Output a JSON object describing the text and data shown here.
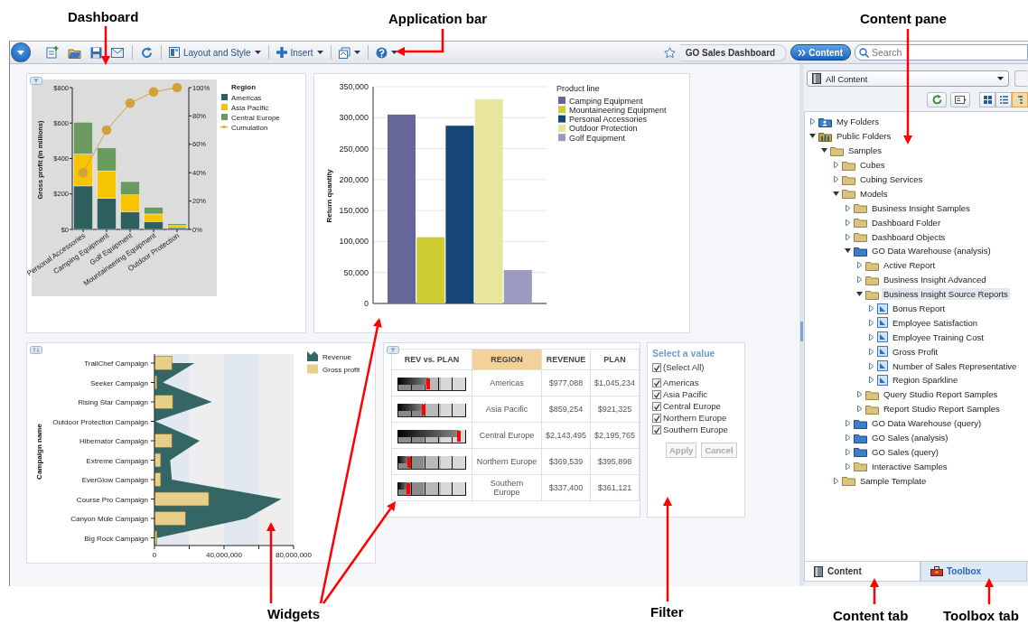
{
  "callouts": [
    {
      "text": "Dashboard"
    },
    {
      "text": "Application bar"
    },
    {
      "text": "Content pane"
    },
    {
      "text": "Widgets"
    },
    {
      "text": "Filter"
    },
    {
      "text": "Content tab"
    },
    {
      "text": "Toolbox tab"
    }
  ],
  "toolbar": {
    "menus": [
      {
        "label": "Layout and Style"
      },
      {
        "label": "Insert"
      }
    ],
    "dashboard_title": "GO Sales Dashboard",
    "content_button": "Content",
    "search": {
      "placeholder": "Search"
    }
  },
  "widgets": [
    {
      "kind": "pareto",
      "chart_data": {
        "type": "bar",
        "stacked": true,
        "ylabel": "Gross profit (in millions)",
        "legend": {
          "title": "Region"
        },
        "categories": [
          "Personal Accessories",
          "Camping Equipment",
          "Golf Equipment",
          "Mountaineering Equipment",
          "Outdoor Protection"
        ],
        "series": [
          {
            "name": "Americas",
            "color": "#2f5f5e",
            "values": [
              245,
              175,
              100,
              45,
              10
            ]
          },
          {
            "name": "Asia Pacific",
            "color": "#f6c400",
            "values": [
              180,
              155,
              95,
              42,
              12
            ]
          },
          {
            "name": "Central Europe",
            "color": "#6a9a5f",
            "values": [
              180,
              130,
              75,
              38,
              10
            ]
          },
          {
            "name": "Cumulation",
            "color": "#d4a03a",
            "type": "line",
            "axis": "y2",
            "marker": "circle",
            "values": [
              40,
              70,
              89,
              97,
              100
            ]
          }
        ],
        "ylim": [
          0,
          800
        ],
        "yticks": [
          {
            "value": 0,
            "label": "$0"
          },
          {
            "value": 200,
            "label": "$200"
          },
          {
            "value": 400,
            "label": "$400"
          },
          {
            "value": 600,
            "label": "$600"
          },
          {
            "value": 800,
            "label": "$800"
          }
        ],
        "y2lim": [
          0,
          100
        ],
        "y2ticks": [
          {
            "value": 0,
            "label": "0%"
          },
          {
            "value": 20,
            "label": "20%"
          },
          {
            "value": 40,
            "label": "40%"
          },
          {
            "value": 60,
            "label": "60%"
          },
          {
            "value": 80,
            "label": "80%"
          },
          {
            "value": 100,
            "label": "100%"
          }
        ]
      }
    },
    {
      "kind": "bar",
      "chart_data": {
        "type": "bar",
        "ylabel": "Return quantity",
        "grid": true,
        "legend": {
          "title": "Product line"
        },
        "series": [
          {
            "name": "Camping Equipment",
            "color": "#66669a",
            "values": [
              305000
            ]
          },
          {
            "name": "Mountaineering Equipment",
            "color": "#cdcd33",
            "values": [
              107000
            ]
          },
          {
            "name": "Personal Accessories",
            "color": "#154676",
            "values": [
              287000
            ]
          },
          {
            "name": "Outdoor Protection",
            "color": "#e8e69a",
            "values": [
              330000
            ]
          },
          {
            "name": "Golf Equipment",
            "color": "#9b9bc1",
            "values": [
              54000
            ]
          }
        ],
        "ylim": [
          0,
          350000
        ],
        "yticks": [
          {
            "value": 0,
            "label": "0"
          },
          {
            "value": 50000,
            "label": "50,000"
          },
          {
            "value": 100000,
            "label": "100,000"
          },
          {
            "value": 150000,
            "label": "150,000"
          },
          {
            "value": 200000,
            "label": "200,000"
          },
          {
            "value": 250000,
            "label": "250,000"
          },
          {
            "value": 300000,
            "label": "300,000"
          },
          {
            "value": 350000,
            "label": "350,000"
          }
        ]
      }
    },
    {
      "kind": "combo",
      "chart_data": {
        "type": "bar",
        "orientation": "horizontal",
        "ylabel": "Campaign name",
        "legend": true,
        "categories": [
          "TrailChef Campaign",
          "Seeker Campaign",
          "Rising Star Campaign",
          "Outdoor Protection Campaign",
          "Hibernator Campaign",
          "Extreme Campaign",
          "EverGlow Campaign",
          "Course Pro Campaign",
          "Canyon Mule Campaign",
          "Big Rock Campaign"
        ],
        "series": [
          {
            "name": "Revenue",
            "color": "#336664",
            "type": "area",
            "values": [
              23000000,
              4800000,
              33000000,
              500000,
              26000000,
              9000000,
              10000000,
              73000000,
              53000000,
              1700000
            ]
          },
          {
            "name": "Gross profit",
            "color": "#e6cf86",
            "values": [
              10000000,
              1400000,
              10500000,
              null,
              10000000,
              3600000,
              3600000,
              31200000,
              17800000,
              1400000
            ]
          }
        ],
        "bands": [
          {
            "axis": "x",
            "from": 0,
            "to": 20000000,
            "color": "#e2e8ef"
          },
          {
            "axis": "x",
            "from": 40000000,
            "to": 60000000,
            "color": "#e2e8ef"
          }
        ],
        "xlim": [
          0,
          80000000
        ],
        "xticks": [
          {
            "value": 0,
            "label": "0"
          },
          {
            "value": 40000000,
            "label": "40,000,000"
          },
          {
            "value": 80000000,
            "label": "80,000,000"
          }
        ]
      }
    },
    {
      "kind": "table",
      "columns": [
        {
          "label": "REV vs. PLAN",
          "selected": false
        },
        {
          "label": "REGION",
          "selected": true
        },
        {
          "label": "REVENUE",
          "selected": false
        },
        {
          "label": "PLAN",
          "selected": false
        }
      ],
      "rows": [
        {
          "region": "Americas",
          "revenue": "$977,088",
          "plan": "$1,045,234",
          "level": 0.45
        },
        {
          "region": "Asia Pacific",
          "revenue": "$859,254",
          "plan": "$921,325",
          "level": 0.38
        },
        {
          "region": "Central Europe",
          "revenue": "$2,143,495",
          "plan": "$2,195,765",
          "level": 0.9
        },
        {
          "region": "Northern Europe",
          "revenue": "$369,539",
          "plan": "$395,898",
          "level": 0.17
        },
        {
          "region": "Southern Europe",
          "revenue": "$337,400",
          "plan": "$361,121",
          "level": 0.16
        }
      ]
    },
    {
      "kind": "filter",
      "title": "Select a value",
      "options": [
        {
          "label": "(Select All)",
          "checked": true
        },
        {
          "label": "Americas",
          "checked": true
        },
        {
          "label": "Asia Pacific",
          "checked": true
        },
        {
          "label": "Central Europe",
          "checked": true
        },
        {
          "label": "Northern Europe",
          "checked": true
        },
        {
          "label": "Southern Europe",
          "checked": true
        }
      ],
      "buttons": [
        {
          "label": "Apply",
          "disabled": true
        },
        {
          "label": "Cancel",
          "disabled": true
        }
      ]
    }
  ],
  "content_pane": {
    "scope_dropdown": {
      "value": "All Content"
    },
    "view_buttons": [
      {
        "kind": "grid",
        "selected": false
      },
      {
        "kind": "list",
        "selected": false
      },
      {
        "kind": "tree",
        "selected": true
      }
    ],
    "tree": [
      {
        "label": "My Folders",
        "kind": "user-folder",
        "expanded": false,
        "selected": false
      },
      {
        "label": "Public Folders",
        "kind": "public-folder",
        "expanded": true,
        "selected": false,
        "children": [
          {
            "label": "Samples",
            "kind": "folder",
            "expanded": true,
            "selected": false,
            "children": [
              {
                "label": "Cubes",
                "kind": "folder",
                "expanded": false,
                "selected": false
              },
              {
                "label": "Cubing Services",
                "kind": "folder",
                "expanded": false,
                "selected": false
              },
              {
                "label": "Models",
                "kind": "folder",
                "expanded": true,
                "selected": false,
                "children": [
                  {
                    "label": "Business Insight Samples",
                    "kind": "folder",
                    "expanded": false,
                    "selected": false
                  },
                  {
                    "label": "Dashboard Folder",
                    "kind": "folder",
                    "expanded": false,
                    "selected": false
                  },
                  {
                    "label": "Dashboard Objects",
                    "kind": "folder",
                    "expanded": false,
                    "selected": false
                  },
                  {
                    "label": "GO Data Warehouse (analysis)",
                    "kind": "package",
                    "expanded": true,
                    "selected": false,
                    "children": [
                      {
                        "label": "Active Report",
                        "kind": "folder",
                        "expanded": false,
                        "selected": false
                      },
                      {
                        "label": "Business Insight Advanced",
                        "kind": "folder",
                        "expanded": false,
                        "selected": false
                      },
                      {
                        "label": "Business Insight Source Reports",
                        "kind": "folder",
                        "expanded": true,
                        "selected": true,
                        "children": [
                          {
                            "label": "Bonus Report",
                            "kind": "report",
                            "expanded": false,
                            "selected": false
                          },
                          {
                            "label": "Employee Satisfaction",
                            "kind": "report",
                            "expanded": false,
                            "selected": false
                          },
                          {
                            "label": "Employee Training Cost",
                            "kind": "report",
                            "expanded": false,
                            "selected": false
                          },
                          {
                            "label": "Gross Profit",
                            "kind": "report",
                            "expanded": false,
                            "selected": false
                          },
                          {
                            "label": "Number of Sales Representative",
                            "kind": "report",
                            "expanded": false,
                            "selected": false
                          },
                          {
                            "label": "Region Sparkline",
                            "kind": "report",
                            "expanded": false,
                            "selected": false
                          }
                        ]
                      },
                      {
                        "label": "Query Studio Report Samples",
                        "kind": "folder",
                        "expanded": false,
                        "selected": false
                      },
                      {
                        "label": "Report Studio Report Samples",
                        "kind": "folder",
                        "expanded": false,
                        "selected": false
                      }
                    ]
                  },
                  {
                    "label": "GO Data Warehouse (query)",
                    "kind": "package",
                    "expanded": false,
                    "selected": false
                  },
                  {
                    "label": "GO Sales (analysis)",
                    "kind": "package",
                    "expanded": false,
                    "selected": false
                  },
                  {
                    "label": "GO Sales (query)",
                    "kind": "package",
                    "expanded": false,
                    "selected": false
                  },
                  {
                    "label": "Interactive Samples",
                    "kind": "folder",
                    "expanded": false,
                    "selected": false
                  }
                ]
              },
              {
                "label": "Sample Template",
                "kind": "folder",
                "expanded": false,
                "selected": false
              }
            ]
          }
        ]
      }
    ],
    "tabs": [
      {
        "label": "Content",
        "selected": true
      },
      {
        "label": "Toolbox",
        "selected": false
      }
    ]
  }
}
